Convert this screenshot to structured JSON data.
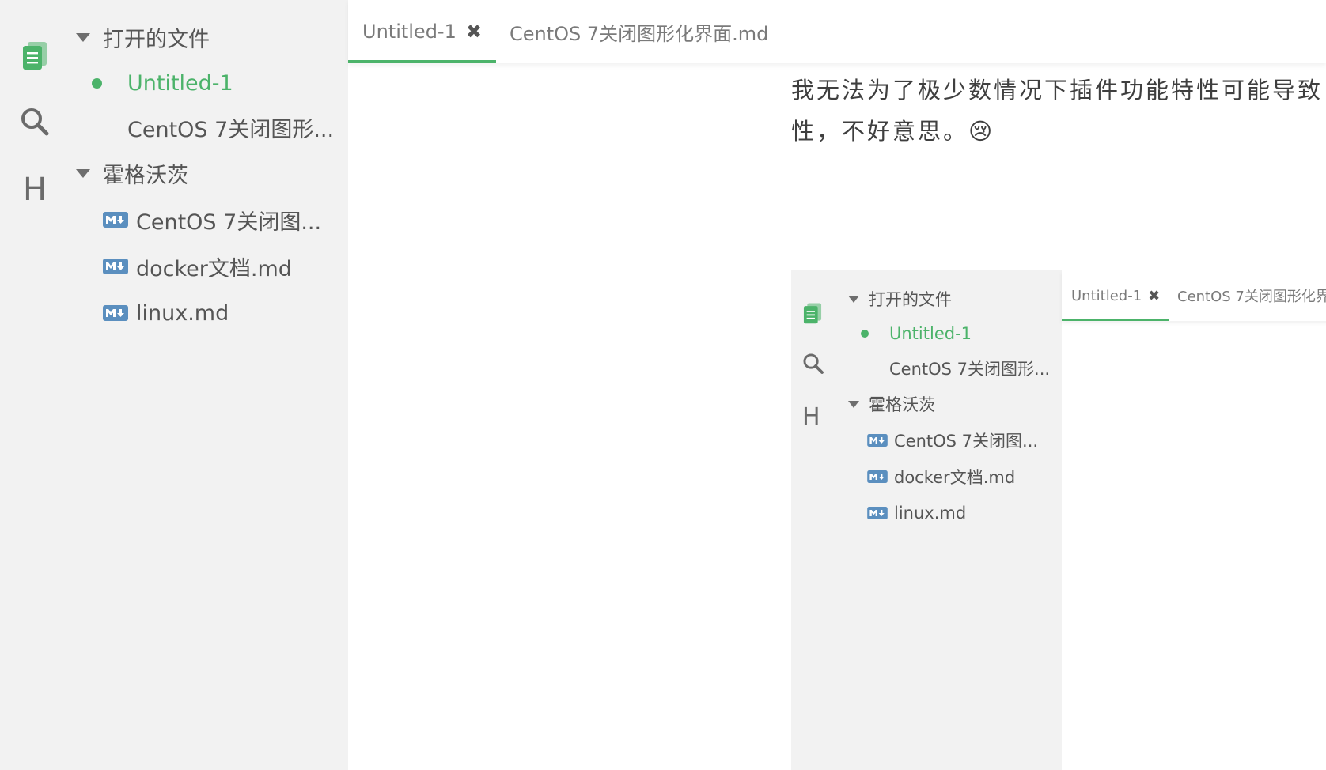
{
  "sidebar": {
    "open_files_header": "打开的文件",
    "open_files": [
      {
        "label": "Untitled-1",
        "active": true
      },
      {
        "label": "CentOS 7关闭图形..."
      }
    ],
    "folder_header": "霍格沃茨",
    "folder_files": [
      {
        "label": "CentOS 7关闭图..."
      },
      {
        "label": "docker文档.md"
      },
      {
        "label": "linux.md"
      }
    ]
  },
  "activity": {
    "icons": [
      "files-icon",
      "search-icon",
      "outline-icon"
    ],
    "outline_letter": "H"
  },
  "tabs": [
    {
      "label": "Untitled-1",
      "active": true,
      "close": "✖"
    },
    {
      "label": "CentOS 7关闭图形化界面.md"
    }
  ],
  "editor": {
    "line1": "我无法为了极少数情况下插件功能特性可能导致",
    "line2": "性，不好意思。",
    "emoji": "😢"
  },
  "embedded_screenshot": {
    "open_files_header": "打开的文件",
    "open_files": [
      {
        "label": "Untitled-1",
        "active": true
      },
      {
        "label": "CentOS 7关闭图形..."
      }
    ],
    "folder_header": "霍格沃茨",
    "folder_files": [
      {
        "label": "CentOS 7关闭图..."
      },
      {
        "label": "docker文档.md"
      },
      {
        "label": "linux.md"
      }
    ],
    "outline_letter": "H",
    "tabs": [
      {
        "label": "Untitled-1",
        "close": "✖"
      },
      {
        "label": "CentOS 7关闭图形化界"
      }
    ]
  },
  "colors": {
    "accent": "#4cb36a",
    "sidebar_bg": "#f2f2f2",
    "md_badge": "#5b8fbf"
  }
}
